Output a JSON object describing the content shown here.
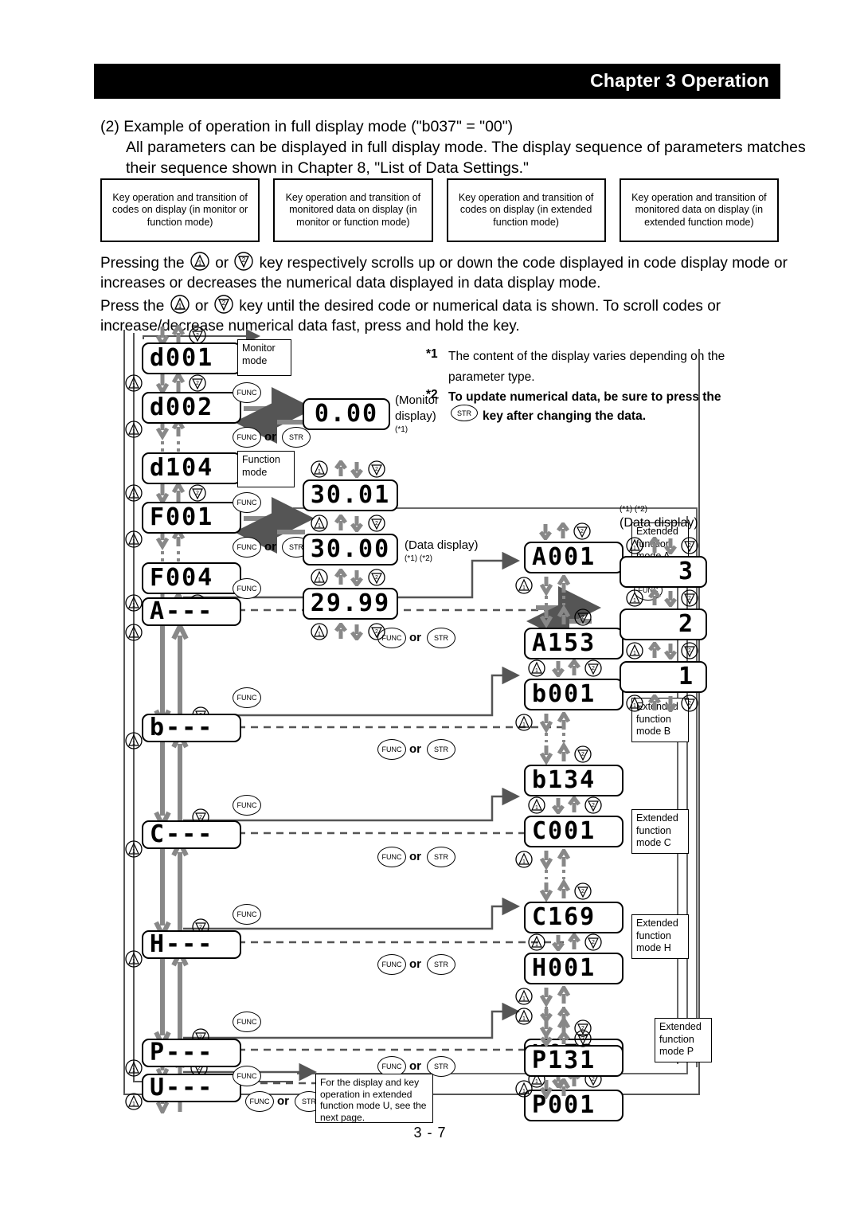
{
  "header": {
    "chapter_title": "Chapter 3 Operation"
  },
  "intro": {
    "line1": "(2)  Example of operation in full display mode (\"b037\" = \"00\")",
    "line2": "All parameters can be displayed in full display mode. The display sequence of parameters matches",
    "line3": "their sequence shown in Chapter 8, \"List of Data Settings.\""
  },
  "legend_boxes": [
    "Key operation and transition of codes on display (in monitor or function mode)",
    "Key operation and transition of monitored data on display (in monitor or function mode)",
    "Key operation and transition of codes on display (in extended function mode)",
    "Key operation and transition of monitored data on display (in extended function mode)"
  ],
  "paragraph": {
    "p1_a": "Pressing the",
    "p1_or": "or",
    "p1_b": "key respectively scrolls up or down the code displayed in code display mode or",
    "p2": "increases or decreases the numerical data displayed in data display mode.",
    "p3_a": "Press the",
    "p3_or": "or",
    "p3_b": "key until the desired code or numerical data is shown. To scroll codes or",
    "p4": "increase/decrease numerical data fast, press and hold the key."
  },
  "footnotes": {
    "star1_mark": "*1",
    "star1_l1": "The content of the display varies depending on the",
    "star1_l2": "parameter type.",
    "star2_mark": "*2",
    "star2_l1": "To update numerical data, be sure to press the",
    "star2_l2": "key after changing the data.",
    "str_key": "STR"
  },
  "keys": {
    "func": "FUNC",
    "str": "STR",
    "or": "or",
    "up_digit": "1",
    "down_digit": "2"
  },
  "diagram": {
    "mode_labels": {
      "monitor": "Monitor\nmode",
      "function": "Function\nmode",
      "ext_a": "Extended\nfunction\nmode A",
      "ext_b": "Extended\nfunction\nmode B",
      "ext_c": "Extended\nfunction\nmode C",
      "ext_h": "Extended\nfunction\nmode H",
      "ext_p": "Extended\nfunction\nmode P"
    },
    "display_labels": {
      "monitor_display": "(Monitor",
      "monitor_display2": "display)",
      "monitor_sup": "(*1)",
      "data_display_mid": "(Data display)",
      "data_display_mid_sup": "(*1) (*2)",
      "data_display_right": "(Data display)",
      "data_display_right_sup": "(*1) (*2)"
    },
    "u_note": "For the display and key operation in extended function mode U, see the next page.",
    "codes_left": [
      "d001",
      "d002",
      "d104",
      "F001",
      "F004",
      "A---",
      "b---",
      "C---",
      "H---",
      "P---",
      "U---"
    ],
    "monitor_values": [
      "0.00"
    ],
    "data_values_mid": [
      "30.01",
      "30.00",
      "29.99"
    ],
    "codes_ext": [
      "A001",
      "A153",
      "b001",
      "b134",
      "C001",
      "C169",
      "H001",
      "H073",
      "P001",
      "P131"
    ],
    "data_values_right": [
      "3",
      "2",
      "1"
    ]
  },
  "page_number": "3 - 7"
}
